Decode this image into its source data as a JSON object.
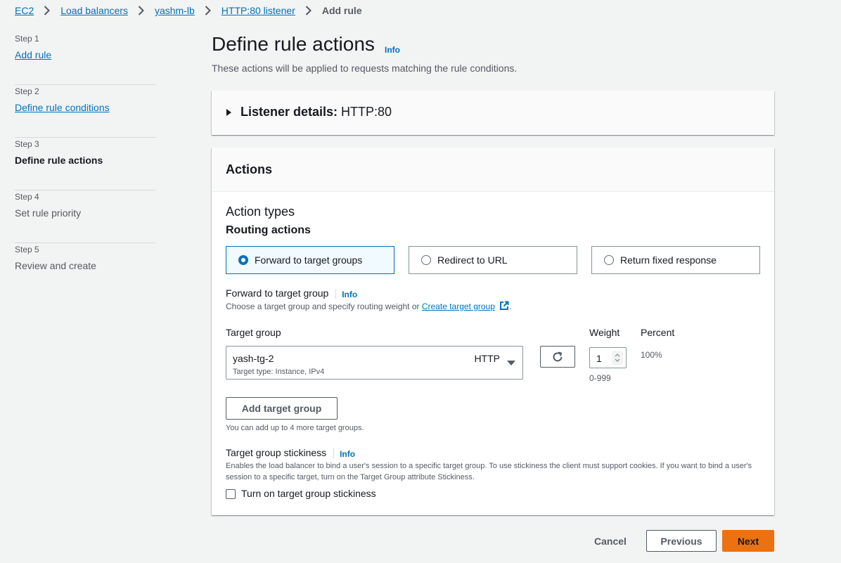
{
  "breadcrumb": {
    "items": [
      "EC2",
      "Load balancers",
      "yashm-lb",
      "HTTP:80 listener"
    ],
    "current": "Add rule"
  },
  "steps": [
    {
      "num": "Step 1",
      "title": "Add rule",
      "state": "link"
    },
    {
      "num": "Step 2",
      "title": "Define rule conditions",
      "state": "link"
    },
    {
      "num": "Step 3",
      "title": "Define rule actions",
      "state": "active"
    },
    {
      "num": "Step 4",
      "title": "Set rule priority",
      "state": "disabled"
    },
    {
      "num": "Step 5",
      "title": "Review and create",
      "state": "disabled"
    }
  ],
  "header": {
    "title": "Define rule actions",
    "info": "Info",
    "description": "These actions will be applied to requests matching the rule conditions."
  },
  "listener": {
    "label": "Listener details:",
    "value": "HTTP:80"
  },
  "actions": {
    "title": "Actions",
    "action_types": "Action types",
    "routing_actions": "Routing actions",
    "tiles": [
      {
        "label": "Forward to target groups",
        "selected": true
      },
      {
        "label": "Redirect to URL",
        "selected": false
      },
      {
        "label": "Return fixed response",
        "selected": false
      }
    ],
    "forward": {
      "label": "Forward to target group",
      "info": "Info",
      "desc_prefix": "Choose a target group and specify routing weight or ",
      "desc_link": "Create target group",
      "desc_suffix": "."
    },
    "target_group": {
      "label": "Target group",
      "value": "yash-tg-2",
      "desc": "Target type: Instance, IPv4",
      "protocol": "HTTP"
    },
    "weight": {
      "label": "Weight",
      "value": "1",
      "hint": "0-999"
    },
    "percent": {
      "label": "Percent",
      "value": "100%"
    },
    "add_target_group": "Add target group",
    "add_hint": "You can add up to 4 more target groups.",
    "stickiness": {
      "label": "Target group stickiness",
      "info": "Info",
      "desc": "Enables the load balancer to bind a user's session to a specific target group. To use stickiness the client must support cookies. If you want to bind a user's session to a specific target, turn on the Target Group attribute Stickiness.",
      "checkbox_label": "Turn on target group stickiness",
      "checked": false
    }
  },
  "footer": {
    "cancel": "Cancel",
    "previous": "Previous",
    "next": "Next"
  },
  "colors": {
    "link": "#0073bb",
    "primary": "#ec7211",
    "background": "#f2f3f3"
  }
}
